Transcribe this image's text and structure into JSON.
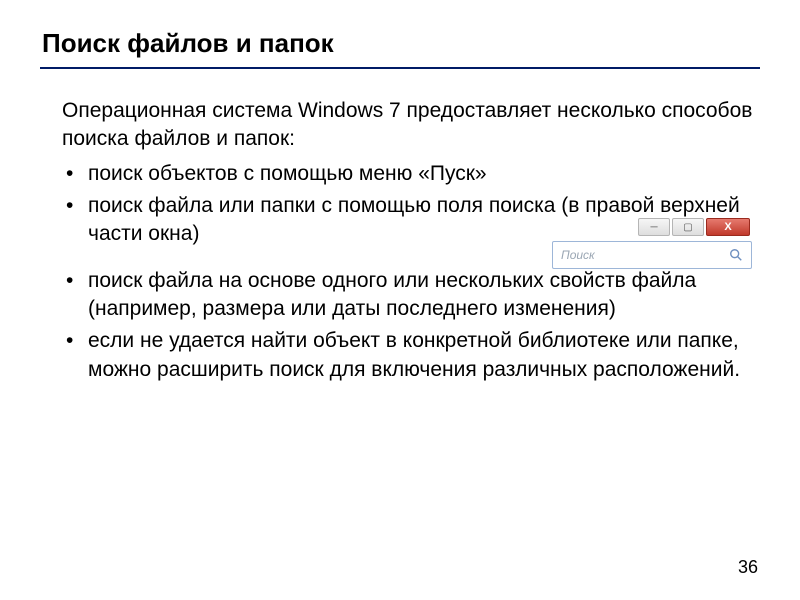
{
  "title": "Поиск файлов и папок",
  "intro": "Операционная система Windows 7 предоставляет несколько способов поиска файлов и папок:",
  "bullets": [
    "поиск объектов с помощью меню «Пуск»",
    "поиск файла или папки с помощью поля поиска (в правой верхней части окна)",
    "поиск файла на основе одного или нескольких свойств файла (например, размера или даты последнего изменения)",
    "если не удается найти объект в конкретной библиотеке или папке, можно расширить поиск для включения различных расположений."
  ],
  "search_widget": {
    "placeholder": "Поиск"
  },
  "window_controls": {
    "minimize": "─",
    "maximize": "▢",
    "close": "X"
  },
  "page_number": "36"
}
